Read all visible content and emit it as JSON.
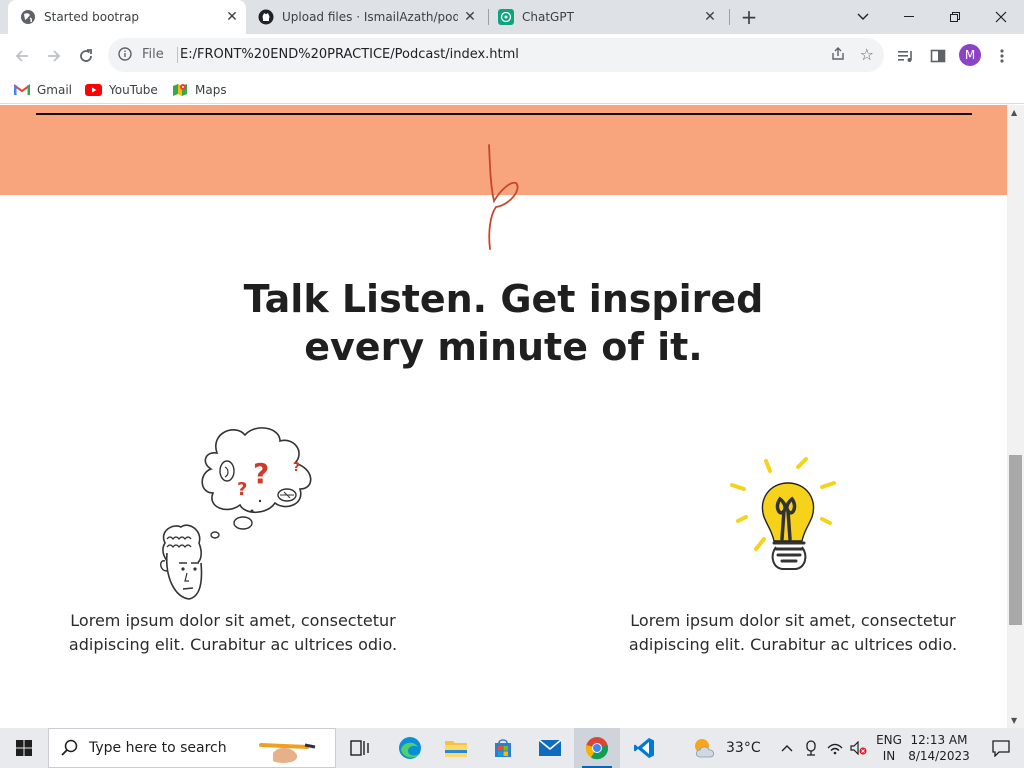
{
  "browser": {
    "tabs": [
      {
        "title": "Started bootrap",
        "favicon": "globe-icon",
        "active": true
      },
      {
        "title": "Upload files · IsmailAzath/podcas",
        "favicon": "github-icon",
        "active": false
      },
      {
        "title": "ChatGPT",
        "favicon": "chatgpt-icon",
        "active": false
      }
    ],
    "close_glyph": "✕",
    "new_tab_glyph": "+",
    "address": {
      "scheme_label": "File",
      "url": "E:/FRONT%20END%20PRACTICE/Podcast/index.html"
    },
    "profile_initial": "M"
  },
  "bookmarks": [
    {
      "label": "Gmail",
      "icon": "gmail-icon"
    },
    {
      "label": "YouTube",
      "icon": "youtube-icon"
    },
    {
      "label": "Maps",
      "icon": "maps-icon"
    }
  ],
  "page": {
    "headline_line1": "Talk Listen. Get inspired",
    "headline_line2": "every minute of it.",
    "features": [
      {
        "illustration": "confused-thinker-illustration",
        "text": "Lorem ipsum dolor sit amet, consectetur adipiscing elit. Curabitur ac ultrices odio."
      },
      {
        "illustration": "lightbulb-illustration",
        "text": "Lorem ipsum dolor sit amet, consectetur adipiscing elit. Curabitur ac ultrices odio."
      }
    ],
    "colors": {
      "peach": "#f8a47d",
      "squiggle": "#c8452f",
      "bulb": "#f6d31a"
    }
  },
  "taskbar": {
    "search_placeholder": "Type here to search",
    "apps": [
      "task-view-icon",
      "edge-icon",
      "file-explorer-icon",
      "store-icon",
      "mail-icon",
      "chrome-icon",
      "vscode-icon"
    ],
    "weather": "33°C",
    "language_line1": "ENG",
    "language_line2": "IN",
    "time": "12:13 AM",
    "date": "8/14/2023"
  }
}
